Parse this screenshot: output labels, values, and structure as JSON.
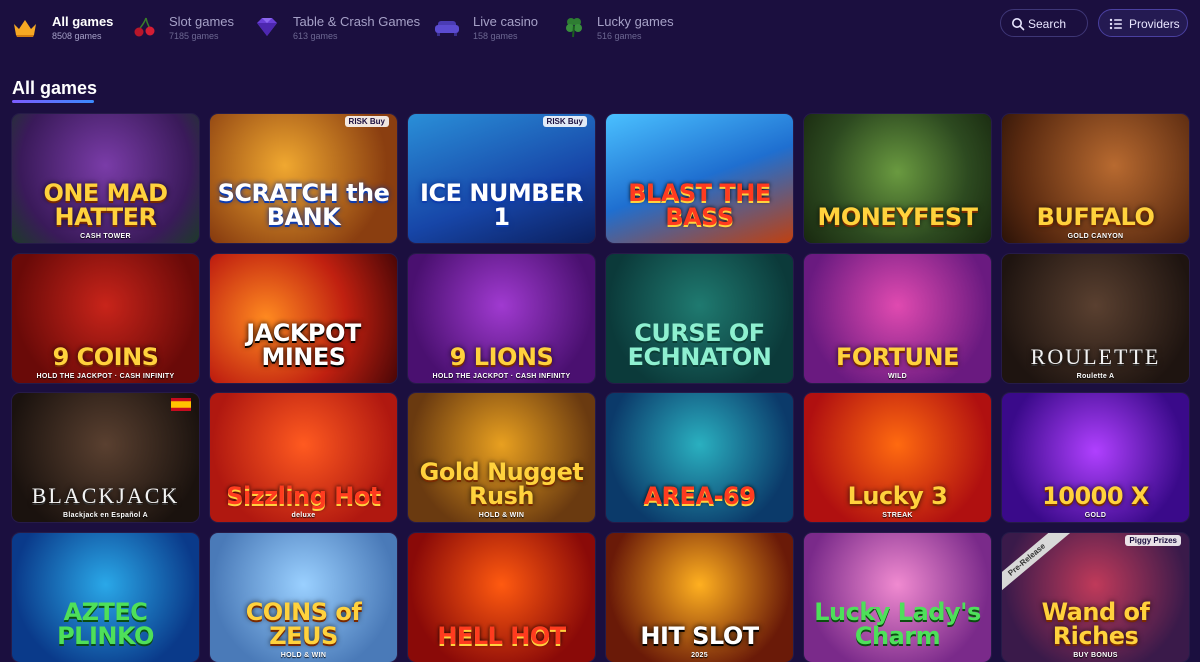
{
  "nav": {
    "categories": [
      {
        "label": "All games",
        "count": "8508 games",
        "icon": "crown-icon"
      },
      {
        "label": "Slot games",
        "count": "7185 games",
        "icon": "cherries-icon"
      },
      {
        "label": "Table & Crash Games",
        "count": "613 games",
        "icon": "diamond-icon"
      },
      {
        "label": "Live casino",
        "count": "158 games",
        "icon": "couch-icon"
      },
      {
        "label": "Lucky games",
        "count": "516 games",
        "icon": "clover-icon"
      }
    ],
    "search_label": "Search",
    "providers_label": "Providers"
  },
  "section": {
    "title": "All games"
  },
  "colors": {
    "background": "#1b0f3f",
    "accent": "#7c5cff",
    "accent2": "#3b8bff"
  },
  "games": [
    {
      "title": "ONE MAD HATTER",
      "sub": "CASH TOWER"
    },
    {
      "title": "SCRATCH the BANK",
      "corner": "RISK Buy"
    },
    {
      "title": "ICE NUMBER 1",
      "corner": "RISK Buy"
    },
    {
      "title": "BLAST THE BASS"
    },
    {
      "title": "MONEYFEST"
    },
    {
      "title": "BUFFALO",
      "sub": "GOLD CANYON"
    },
    {
      "title": "9 COINS",
      "sub": "HOLD THE JACKPOT · CASH INFINITY"
    },
    {
      "title": "JACKPOT MINES"
    },
    {
      "title": "9 LIONS",
      "sub": "HOLD THE JACKPOT · CASH INFINITY"
    },
    {
      "title": "CURSE OF ECHNATON"
    },
    {
      "title": "FORTUNE",
      "sub": "WILD"
    },
    {
      "title": "ROULETTE",
      "sub": "Roulette A"
    },
    {
      "title": "BLACKJACK",
      "sub": "Blackjack en Español A"
    },
    {
      "title": "Sizzling Hot",
      "sub": "deluxe"
    },
    {
      "title": "Gold Nugget Rush",
      "sub": "HOLD & WIN"
    },
    {
      "title": "AREA-69"
    },
    {
      "title": "Lucky 3",
      "sub": "STREAK"
    },
    {
      "title": "10000 X",
      "sub": "GOLD"
    },
    {
      "title": "AZTEC PLINKO"
    },
    {
      "title": "COINS of ZEUS",
      "sub": "HOLD & WIN"
    },
    {
      "title": "HELL HOT"
    },
    {
      "title": "HIT SLOT",
      "sub": "2025"
    },
    {
      "title": "Lucky Lady's Charm"
    },
    {
      "title": "Wand of Riches",
      "sub": "BUY BONUS",
      "diag": "Pre-Release",
      "corner": "Piggy Prizes"
    }
  ]
}
